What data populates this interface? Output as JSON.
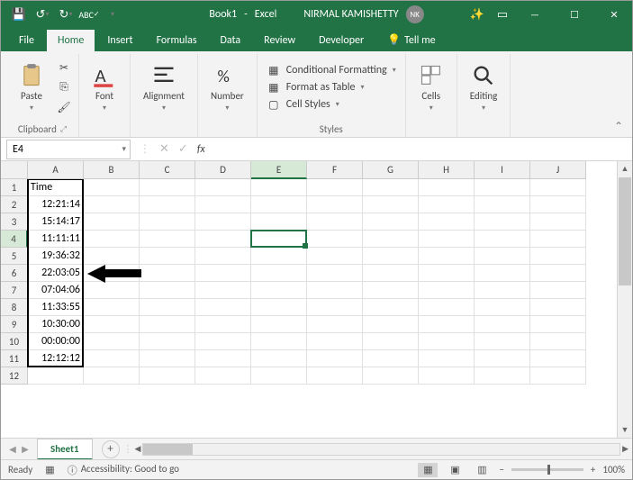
{
  "title": {
    "book": "Book1",
    "app": "Excel",
    "user": "NIRMAL KAMISHETTY",
    "initials": "NK"
  },
  "tabs": {
    "file": "File",
    "home": "Home",
    "insert": "Insert",
    "formulas": "Formulas",
    "data": "Data",
    "review": "Review",
    "developer": "Developer",
    "tellme": "Tell me"
  },
  "ribbon": {
    "paste": "Paste",
    "clipboard": "Clipboard",
    "font": "Font",
    "alignment": "Alignment",
    "number": "Number",
    "styles": "Styles",
    "cf": "Conditional Formatting",
    "fat": "Format as Table",
    "cs": "Cell Styles",
    "cells": "Cells",
    "editing": "Editing"
  },
  "namebox": "E4",
  "cols": [
    "A",
    "B",
    "C",
    "D",
    "E",
    "F",
    "G",
    "H",
    "I",
    "J"
  ],
  "rows": [
    "1",
    "2",
    "3",
    "4",
    "5",
    "6",
    "7",
    "8",
    "9",
    "10",
    "11",
    "12"
  ],
  "cells": {
    "A1": "Time",
    "A2": "12:21:14",
    "A3": "15:14:17",
    "A4": "11:11:11",
    "A5": "19:36:32",
    "A6": "22:03:05",
    "A7": "07:04:06",
    "A8": "11:33:55",
    "A9": "10:30:00",
    "A10": "00:00:00",
    "A11": "12:12:12"
  },
  "sheet": {
    "tab": "Sheet1"
  },
  "status": {
    "ready": "Ready",
    "access": "Accessibility: Good to go",
    "zoom": "100%"
  }
}
